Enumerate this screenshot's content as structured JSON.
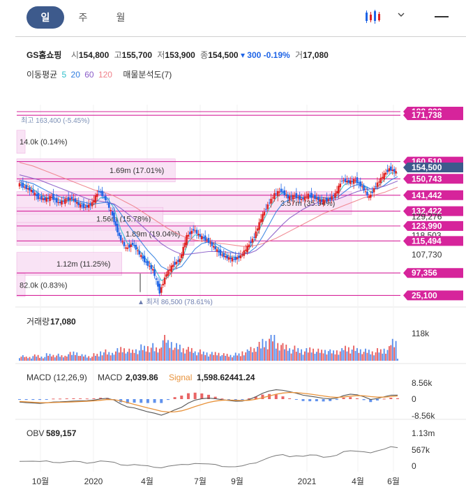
{
  "tabs": [
    {
      "label": "일",
      "active": true
    },
    {
      "label": "주",
      "active": false
    },
    {
      "label": "월",
      "active": false
    }
  ],
  "quote": {
    "name": "GS홈쇼핑",
    "open_label": "시",
    "open": "154,800",
    "high_label": "고",
    "high": "155,700",
    "low_label": "저",
    "low": "153,900",
    "close_label": "종",
    "close": "154,500",
    "change": "▾ 300",
    "change_pct": "-0.19%",
    "volume_label": "거",
    "volume": "17,080"
  },
  "ma": {
    "title": "이동평균",
    "p5": "5",
    "p20": "20",
    "p60": "60",
    "p120": "120",
    "profile_label": "매물분석도(7)"
  },
  "colors": {
    "accent": "#3d5a8c",
    "up": "#e02424",
    "down": "#1e64e6",
    "level": "#d6249b",
    "ma5": "#2dbfca",
    "ma20": "#2e7de0",
    "ma60": "#8a5cc8",
    "ma120": "#f0808a",
    "macd_signal": "#e8923a"
  },
  "icons": {
    "chart_type": "candle-chart-icon",
    "chevron": "chevron-down-icon",
    "menu": "hamburger-menu-icon"
  },
  "chart_data": {
    "type": "line",
    "x_tick_labels": [
      "10월",
      "2020",
      "4월",
      "7월",
      "9월",
      "2021",
      "4월",
      "6월"
    ],
    "price": {
      "ylim": [
        82000,
        192000
      ],
      "values": [
        148000,
        146000,
        144000,
        140000,
        139000,
        140500,
        137000,
        138500,
        139800,
        136000,
        134500,
        137000,
        144000,
        139000,
        130000,
        118000,
        111000,
        114000,
        108000,
        103000,
        99000,
        86500,
        97000,
        102000,
        105000,
        118000,
        122000,
        118000,
        116000,
        112000,
        108000,
        106000,
        105000,
        107000,
        112000,
        118000,
        128000,
        136000,
        142000,
        144000,
        140000,
        141000,
        139000,
        141500,
        140000,
        138000,
        139000,
        142000,
        150000,
        149000,
        150000,
        146000,
        140000,
        147000,
        152000,
        156500,
        154500
      ],
      "ma_lines": [
        {
          "period": "5",
          "values": [
            149000,
            147000,
            145000,
            142000,
            140000,
            140000,
            138500,
            138000,
            138500,
            137000,
            135500,
            136000,
            140000,
            140000,
            134000,
            122000,
            114000,
            113000,
            109000,
            104000,
            100000,
            93000,
            95000,
            100000,
            104000,
            115000,
            119000,
            118000,
            116000,
            113000,
            109000,
            107000,
            106000,
            107000,
            111000,
            117000,
            126000,
            134000,
            140000,
            143000,
            141000,
            141000,
            140000,
            141000,
            140000,
            139000,
            139000,
            141000,
            147000,
            149000,
            149000,
            147000,
            143000,
            146000,
            150000,
            154000,
            154000
          ]
        },
        {
          "period": "20",
          "values": [
            150000,
            149000,
            148000,
            146000,
            144000,
            142000,
            140500,
            139500,
            138800,
            138000,
            137000,
            136500,
            137000,
            137500,
            136000,
            131000,
            125000,
            120000,
            115000,
            110000,
            106000,
            101000,
            99000,
            99500,
            101000,
            106000,
            111000,
            114000,
            115000,
            114000,
            112000,
            110000,
            108500,
            108000,
            109000,
            112000,
            118000,
            125000,
            132000,
            137000,
            139000,
            140000,
            140000,
            140500,
            140500,
            140000,
            139500,
            140000,
            143000,
            146000,
            147500,
            147000,
            145000,
            145000,
            147000,
            150000,
            152000
          ]
        },
        {
          "period": "60",
          "values": [
            153000,
            152000,
            151000,
            150000,
            148500,
            147000,
            145500,
            144000,
            142500,
            141000,
            139500,
            138500,
            138000,
            137500,
            136500,
            134000,
            131000,
            128000,
            124500,
            121000,
            117500,
            114000,
            111500,
            109500,
            108000,
            108000,
            108500,
            109000,
            109500,
            109500,
            109500,
            109000,
            108500,
            108000,
            108500,
            110000,
            113000,
            117000,
            121000,
            125000,
            128500,
            131000,
            133500,
            135500,
            137000,
            138000,
            138500,
            139000,
            140500,
            142000,
            143500,
            144500,
            145000,
            145500,
            146500,
            148000,
            149500
          ]
        },
        {
          "period": "120",
          "values": [
            160000,
            159000,
            158000,
            156500,
            155000,
            153500,
            152000,
            150500,
            149000,
            147500,
            146000,
            144500,
            143500,
            142500,
            141000,
            139000,
            137000,
            135000,
            132500,
            130000,
            127500,
            125000,
            122500,
            120500,
            118500,
            117000,
            116000,
            115500,
            115000,
            114500,
            114000,
            113500,
            113000,
            112500,
            112500,
            113000,
            114000,
            115500,
            117000,
            119000,
            121000,
            123000,
            125000,
            127000,
            129000,
            131000,
            132500,
            134000,
            135500,
            137000,
            138500,
            140000,
            141000,
            142000,
            143000,
            144500,
            146000
          ]
        }
      ]
    },
    "right_axis_labels": [
      {
        "text": "188,833",
        "style": "level",
        "value": 188833
      },
      {
        "text": "171,738",
        "style": "level",
        "value": 186800
      },
      {
        "text": "160,510",
        "style": "level",
        "value": 160510
      },
      {
        "text": "154,500",
        "style": "current",
        "value": 157200
      },
      {
        "text": "150,743",
        "style": "level",
        "value": 150743
      },
      {
        "text": "141,442",
        "style": "level",
        "value": 141442
      },
      {
        "text": "132,422",
        "style": "level",
        "value": 132422
      },
      {
        "text": "129,276",
        "style": "plain",
        "value": 129276
      },
      {
        "text": "123,990",
        "style": "level",
        "value": 123990
      },
      {
        "text": "118,503",
        "style": "plain",
        "value": 118503
      },
      {
        "text": "115,494",
        "style": "level",
        "value": 115494
      },
      {
        "text": "107,730",
        "style": "plain",
        "value": 107730
      },
      {
        "text": "97,356",
        "style": "level",
        "value": 97356
      },
      {
        "text": "25,100",
        "style": "level",
        "value": 84600
      }
    ],
    "volume_profile": [
      {
        "label": "14.0k (0.14%)",
        "value": 14000,
        "y": 171738
      },
      {
        "label": "1.69m (17.01%)",
        "value": 1690000,
        "y": 155500
      },
      {
        "label": "3.57m (35.94%)",
        "value": 3570000,
        "y": 137000
      },
      {
        "label": "1.56m (15.78%)",
        "value": 1560000,
        "y": 128000
      },
      {
        "label": "1.89m (19.04%)",
        "value": 1890000,
        "y": 119500
      },
      {
        "label": "1.12m (11.25%)",
        "value": 1120000,
        "y": 102500
      },
      {
        "label": "82.0k (0.83%)",
        "value": 82000,
        "y": 90500
      }
    ],
    "annotations": {
      "high": "최고 163,400 (-5.45%)",
      "low": "최저 86,500 (78.61%)"
    },
    "volume": {
      "title": "거래량",
      "last": "17,080",
      "max_label": "118k",
      "ymax": 118000,
      "values": [
        22,
        18,
        25,
        20,
        30,
        28,
        24,
        35,
        40,
        26,
        22,
        30,
        45,
        38,
        50,
        60,
        48,
        55,
        65,
        70,
        58,
        110,
        90,
        70,
        60,
        55,
        45,
        40,
        35,
        38,
        30,
        28,
        32,
        45,
        60,
        75,
        95,
        118,
        85,
        70,
        60,
        55,
        50,
        58,
        48,
        52,
        45,
        50,
        65,
        60,
        55,
        48,
        45,
        50,
        58,
        95,
        17
      ]
    },
    "macd": {
      "title": "MACD (12,26,9)",
      "macd_label": "MACD",
      "macd": "2,039.86",
      "signal_label": "Signal",
      "signal": "1,598.62441.24",
      "ticks": [
        "8.56k",
        "0",
        "-8.56k"
      ],
      "ylim": [
        -8560,
        8560
      ],
      "macd_values": [
        -1500,
        -1800,
        -2000,
        -2200,
        -1900,
        -1500,
        -1400,
        -1200,
        -1000,
        -900,
        -800,
        -500,
        100,
        400,
        -500,
        -2500,
        -4000,
        -4500,
        -5500,
        -6500,
        -7200,
        -8200,
        -7000,
        -5500,
        -4200,
        -2000,
        -500,
        200,
        500,
        200,
        -300,
        -700,
        -1100,
        -1000,
        -200,
        1200,
        3000,
        4200,
        4800,
        4500,
        3800,
        3000,
        2000,
        1500,
        1000,
        400,
        100,
        500,
        1800,
        2500,
        2200,
        1200,
        -200,
        300,
        1200,
        2000,
        2039
      ],
      "signal_values": [
        -1200,
        -1400,
        -1600,
        -1800,
        -1850,
        -1750,
        -1650,
        -1550,
        -1400,
        -1250,
        -1100,
        -900,
        -600,
        -200,
        -300,
        -900,
        -1800,
        -2700,
        -3600,
        -4500,
        -5300,
        -6200,
        -6600,
        -6500,
        -6000,
        -5000,
        -3800,
        -2700,
        -1700,
        -1000,
        -600,
        -500,
        -600,
        -700,
        -600,
        -100,
        700,
        1600,
        2500,
        3100,
        3400,
        3300,
        3000,
        2600,
        2100,
        1600,
        1100,
        900,
        1100,
        1500,
        1800,
        1700,
        1300,
        1000,
        1000,
        1300,
        1598
      ]
    },
    "obv": {
      "title": "OBV",
      "value": "589,157",
      "ticks": [
        "1.13m",
        "567k",
        "0"
      ],
      "ylim": [
        -200000,
        1130000
      ],
      "values": [
        100000,
        90000,
        80000,
        60000,
        70000,
        60000,
        40000,
        60000,
        70000,
        40000,
        30000,
        50000,
        90000,
        60000,
        20000,
        -30000,
        -60000,
        -40000,
        -80000,
        -110000,
        -120000,
        -150000,
        -100000,
        -80000,
        -60000,
        -20000,
        10000,
        -10000,
        -30000,
        -60000,
        -90000,
        -110000,
        -120000,
        -100000,
        -40000,
        40000,
        130000,
        220000,
        280000,
        300000,
        270000,
        290000,
        260000,
        300000,
        280000,
        250000,
        260000,
        300000,
        420000,
        440000,
        470000,
        440000,
        390000,
        450000,
        500000,
        640000,
        589157
      ]
    }
  }
}
